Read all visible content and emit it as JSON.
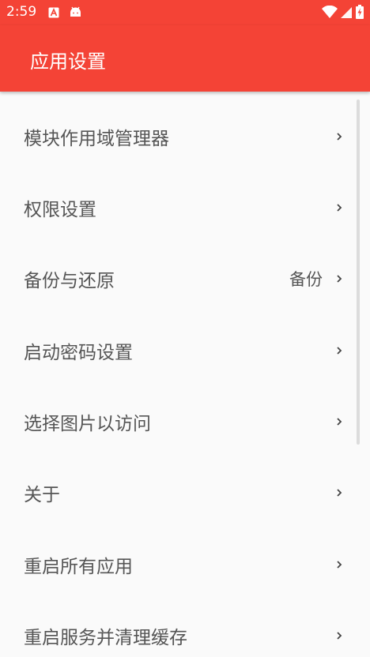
{
  "status_bar": {
    "time": "2:59",
    "icons": [
      "text-notification-icon",
      "android-icon",
      "wifi-icon",
      "signal-icon",
      "battery-charging-icon"
    ],
    "background": "#f44336"
  },
  "app_bar": {
    "title": "应用设置",
    "background": "#f44336"
  },
  "settings": {
    "items": [
      {
        "label": "模块作用域管理器",
        "value": ""
      },
      {
        "label": "权限设置",
        "value": ""
      },
      {
        "label": "备份与还原",
        "value": "备份"
      },
      {
        "label": "启动密码设置",
        "value": ""
      },
      {
        "label": "选择图片以访问",
        "value": ""
      },
      {
        "label": "关于",
        "value": ""
      },
      {
        "label": "重启所有应用",
        "value": ""
      },
      {
        "label": "重启服务并清理缓存",
        "value": ""
      }
    ]
  }
}
